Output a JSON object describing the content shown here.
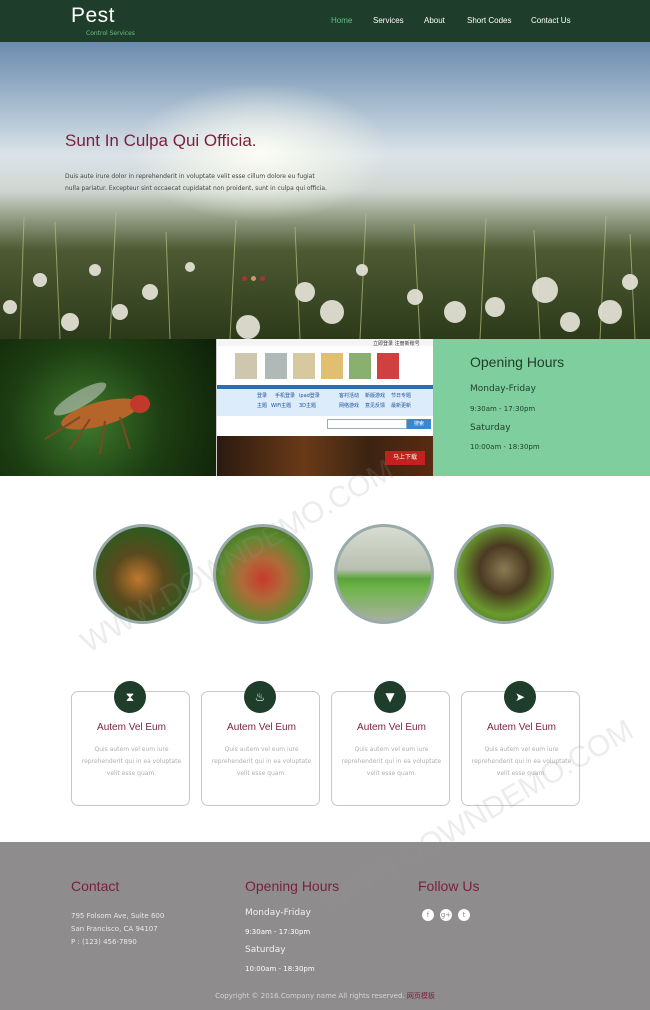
{
  "header": {
    "brand_name": "Pest",
    "brand_tagline": "Control Services",
    "menu": [
      {
        "label": "Home",
        "active": true
      },
      {
        "label": "Services",
        "active": false
      },
      {
        "label": "About",
        "active": false
      },
      {
        "label": "Short Codes",
        "active": false
      },
      {
        "label": "Contact Us",
        "active": false
      }
    ]
  },
  "hero": {
    "title": "Sunt In Culpa Qui Officia.",
    "text": "Duis aute irure dolor in reprehenderit in voluptate velit esse cillum dolore eu fugiat nulla pariatur. Excepteur sint occaecat cupidatat non proident, sunt in culpa qui officia."
  },
  "embedded_screenshot": {
    "top_links": "立即登录  注册新账号",
    "links": [
      "登录",
      "手机登录",
      "ipad登录",
      "主题",
      "WiFi主题",
      "3D主题",
      "客村活动",
      "新版游戏",
      "节日专题",
      "网络游戏",
      "意见反馈",
      "最新更新"
    ],
    "search_button": "搜索",
    "badge": "马上下载"
  },
  "opening_hours": {
    "title": "Opening Hours",
    "weekday_label": "Monday-Friday",
    "weekday_time": "9:30am - 17:30pm",
    "weekend_label": "Saturday",
    "weekend_time": "10:00am - 18:30pm"
  },
  "services": [
    {
      "icon": "hourglass-icon",
      "glyph": "⧗",
      "title": "Autem Vel Eum",
      "text": "Quis autem vel eum iure reprehenderit qui in ea voluptate velit esse quam."
    },
    {
      "icon": "flame-icon",
      "glyph": "♨",
      "title": "Autem Vel Eum",
      "text": "Quis autem vel eum iure reprehenderit qui in ea voluptate velit esse quam."
    },
    {
      "icon": "filter-icon",
      "glyph": "▼",
      "title": "Autem Vel Eum",
      "text": "Quis autem vel eum iure reprehenderit qui in ea voluptate velit esse quam."
    },
    {
      "icon": "send-icon",
      "glyph": "➤",
      "title": "Autem Vel Eum",
      "text": "Quis autem vel eum iure reprehenderit qui in ea voluptate velit esse quam."
    }
  ],
  "footer": {
    "contact": {
      "title": "Contact",
      "address_line1": "795 Folsom Ave, Suite 600",
      "address_line2": "San Francisco, CA 94107",
      "phone": "P : (123) 456-7890"
    },
    "hours": {
      "title": "Opening Hours",
      "weekday_label": "Monday-Friday",
      "weekday_time": "9:30am - 17:30pm",
      "weekend_label": "Saturday",
      "weekend_time": "10:00am - 18:30pm"
    },
    "follow": {
      "title": "Follow Us",
      "networks": [
        "facebook-icon",
        "google-plus-icon",
        "twitter-icon"
      ],
      "glyphs": [
        "f",
        "g+",
        "t"
      ]
    },
    "copyright": "Copyright © 2016.Company name All rights reserved.",
    "copyright_link": "网页模板"
  },
  "watermark": "WWW.DOWNDEMO.COM",
  "colors": {
    "nav_bg": "#1f3d2b",
    "accent_green": "#5fc183",
    "hours_bg": "#7fcf9e",
    "heading_maroon": "#7a1f3d",
    "footer_bg": "#8e8c8d"
  }
}
